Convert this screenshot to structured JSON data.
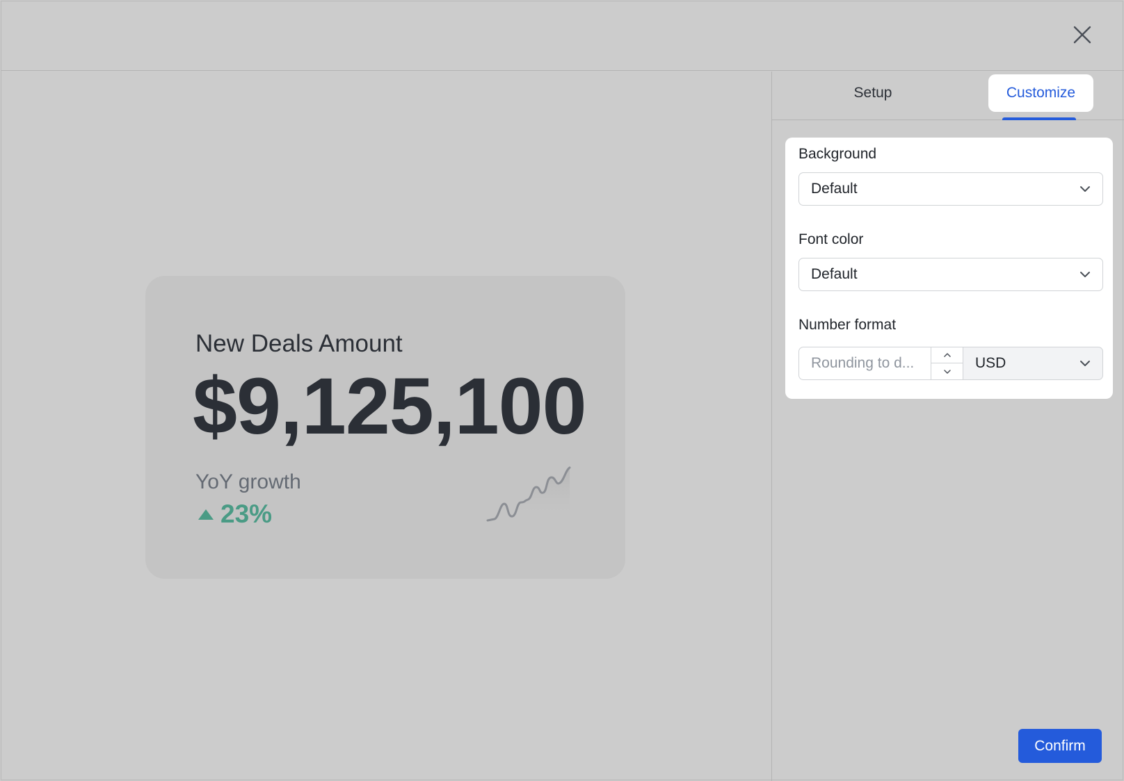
{
  "preview": {
    "card": {
      "title": "New Deals Amount",
      "value": "$9,125,100",
      "growth_label": "YoY growth",
      "growth_value": "23%",
      "growth_direction": "up",
      "growth_color": "#4a9b85"
    }
  },
  "panel": {
    "tabs": [
      {
        "label": "Setup",
        "active": false
      },
      {
        "label": "Customize",
        "active": true
      }
    ],
    "fields": {
      "background": {
        "label": "Background",
        "value": "Default"
      },
      "font_color": {
        "label": "Font color",
        "value": "Default"
      },
      "number_format": {
        "label": "Number format",
        "rounding_placeholder": "Rounding to d...",
        "currency": "USD"
      }
    },
    "confirm_label": "Confirm",
    "accent_color": "#245bdb"
  }
}
